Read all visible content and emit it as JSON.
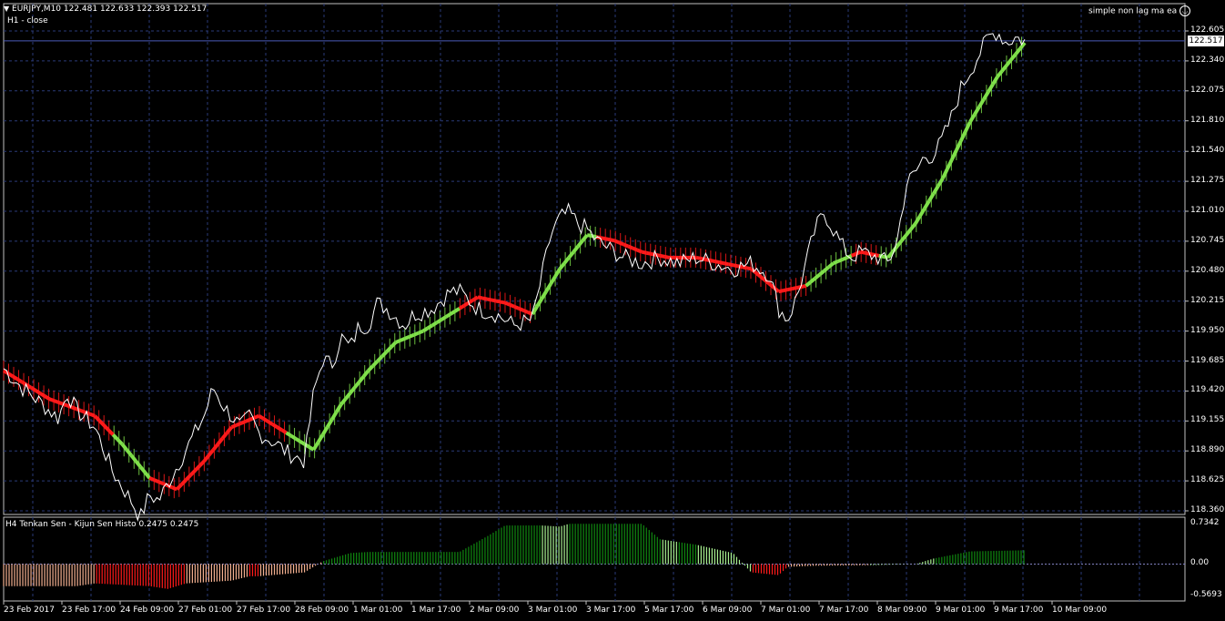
{
  "header": {
    "symbol_line": "EURJPY,M10  122.481 122.633 122.393 122.517",
    "sub_label": "H1 - close",
    "ea_label": "simple non lag ma ea"
  },
  "indicator": {
    "label": "H4  Tenkan Sen - Kijun Sen Histo 0.2475 0.2475",
    "axis": [
      "0.7342",
      "0.00",
      "-0.5693"
    ]
  },
  "current_price": "122.517",
  "price_axis": [
    "122.605",
    "122.340",
    "122.075",
    "121.810",
    "121.540",
    "121.275",
    "121.010",
    "120.745",
    "120.480",
    "120.215",
    "119.950",
    "119.685",
    "119.420",
    "119.155",
    "118.890",
    "118.625",
    "118.360"
  ],
  "date_axis": [
    "23 Feb 2017",
    "23 Feb 17:00",
    "24 Feb 09:00",
    "27 Feb 01:00",
    "27 Feb 17:00",
    "28 Feb 09:00",
    "1 Mar 01:00",
    "1 Mar 17:00",
    "2 Mar 09:00",
    "3 Mar 01:00",
    "3 Mar 17:00",
    "5 Mar 17:00",
    "6 Mar 09:00",
    "7 Mar 01:00",
    "7 Mar 17:00",
    "8 Mar 09:00",
    "9 Mar 01:00",
    "9 Mar 17:00",
    "10 Mar 09:00"
  ],
  "colors": {
    "background": "#000000",
    "grid": "#2a3a78",
    "bull": "#7fe04a",
    "bear": "#ff1a1a",
    "close_line": "#ffffff",
    "histo_up": "#108a10",
    "histo_down": "#ff1a1a",
    "histo_down_light": "#f4b090",
    "histo_up_light": "#a8f090"
  },
  "chart_data": {
    "type": "line",
    "title": "EURJPY,M10",
    "ylim": [
      118.36,
      122.605
    ],
    "price_close_path": [
      [
        0,
        119.62
      ],
      [
        2,
        119.45
      ],
      [
        4,
        119.32
      ],
      [
        6,
        119.18
      ],
      [
        7,
        119.4
      ],
      [
        8,
        119.25
      ],
      [
        10,
        119.1
      ],
      [
        12,
        118.7
      ],
      [
        14,
        118.45
      ],
      [
        15,
        118.3
      ],
      [
        16,
        118.5
      ],
      [
        17,
        118.45
      ],
      [
        18,
        118.6
      ],
      [
        20,
        118.9
      ],
      [
        22,
        119.2
      ],
      [
        23,
        119.45
      ],
      [
        24,
        119.3
      ],
      [
        26,
        119.1
      ],
      [
        27,
        119.2
      ],
      [
        28,
        119.05
      ],
      [
        30,
        118.95
      ],
      [
        31,
        118.88
      ],
      [
        33,
        118.8
      ],
      [
        34,
        119.4
      ],
      [
        35,
        119.7
      ],
      [
        36,
        119.65
      ],
      [
        37,
        119.9
      ],
      [
        38,
        119.8
      ],
      [
        39,
        120.0
      ],
      [
        40,
        120.0
      ],
      [
        41,
        120.2
      ],
      [
        42,
        120.15
      ],
      [
        44,
        120.0
      ],
      [
        45,
        120.1
      ],
      [
        47,
        120.15
      ],
      [
        49,
        120.3
      ],
      [
        50,
        120.3
      ],
      [
        52,
        120.15
      ],
      [
        54,
        120.1
      ],
      [
        56,
        120.0
      ],
      [
        58,
        120.05
      ],
      [
        60,
        120.8
      ],
      [
        61,
        120.95
      ],
      [
        62,
        121.0
      ],
      [
        63,
        120.9
      ],
      [
        64,
        120.85
      ],
      [
        65,
        120.75
      ],
      [
        66,
        120.7
      ],
      [
        68,
        120.6
      ],
      [
        70,
        120.55
      ],
      [
        72,
        120.6
      ],
      [
        74,
        120.55
      ],
      [
        76,
        120.6
      ],
      [
        78,
        120.55
      ],
      [
        80,
        120.5
      ],
      [
        82,
        120.55
      ],
      [
        84,
        120.45
      ],
      [
        85,
        120.15
      ],
      [
        86,
        120.05
      ],
      [
        87,
        120.25
      ],
      [
        88,
        120.55
      ],
      [
        89,
        120.85
      ],
      [
        90,
        121.0
      ],
      [
        91,
        120.85
      ],
      [
        92,
        120.7
      ],
      [
        93,
        120.6
      ],
      [
        94,
        120.65
      ],
      [
        96,
        120.6
      ],
      [
        97,
        120.55
      ],
      [
        98,
        120.75
      ],
      [
        99,
        121.25
      ],
      [
        100,
        121.35
      ],
      [
        101,
        121.5
      ],
      [
        102,
        121.5
      ],
      [
        103,
        121.65
      ],
      [
        104,
        121.85
      ],
      [
        105,
        122.1
      ],
      [
        106,
        122.25
      ],
      [
        107,
        122.4
      ],
      [
        108,
        122.55
      ],
      [
        109,
        122.6
      ],
      [
        110,
        122.5
      ],
      [
        111,
        122.55
      ],
      [
        112,
        122.517
      ]
    ],
    "nonlag_ma": [
      [
        0,
        119.6
      ],
      [
        5,
        119.35
      ],
      [
        10,
        119.2
      ],
      [
        13,
        118.95
      ],
      [
        16,
        118.65
      ],
      [
        19,
        118.55
      ],
      [
        22,
        118.8
      ],
      [
        25,
        119.1
      ],
      [
        28,
        119.2
      ],
      [
        31,
        119.05
      ],
      [
        34,
        118.9
      ],
      [
        37,
        119.3
      ],
      [
        40,
        119.6
      ],
      [
        43,
        119.85
      ],
      [
        46,
        119.95
      ],
      [
        49,
        120.1
      ],
      [
        52,
        120.25
      ],
      [
        55,
        120.2
      ],
      [
        58,
        120.1
      ],
      [
        61,
        120.5
      ],
      [
        64,
        120.8
      ],
      [
        67,
        120.75
      ],
      [
        70,
        120.65
      ],
      [
        73,
        120.6
      ],
      [
        76,
        120.6
      ],
      [
        79,
        120.55
      ],
      [
        82,
        120.5
      ],
      [
        85,
        120.3
      ],
      [
        88,
        120.35
      ],
      [
        91,
        120.55
      ],
      [
        94,
        120.65
      ],
      [
        97,
        120.6
      ],
      [
        100,
        120.9
      ],
      [
        103,
        121.3
      ],
      [
        106,
        121.8
      ],
      [
        109,
        122.2
      ],
      [
        112,
        122.5
      ]
    ],
    "nonlag_trend": "down:0-12,up:12-16,down:16-31,up:31-50,down:50-58,up:58-65,down:65-88,up:88-93,down:93-96,up:96-112",
    "histogram": {
      "ylim": [
        -0.5693,
        0.7342
      ],
      "values": [
        [
          0,
          -0.4,
          "dl"
        ],
        [
          8,
          -0.4,
          "dl"
        ],
        [
          10,
          -0.35,
          "d"
        ],
        [
          16,
          -0.4,
          "d"
        ],
        [
          18,
          -0.45,
          "d"
        ],
        [
          20,
          -0.35,
          "dl"
        ],
        [
          25,
          -0.3,
          "dl"
        ],
        [
          27,
          -0.22,
          "d"
        ],
        [
          28,
          -0.22,
          "dl"
        ],
        [
          33,
          -0.15,
          "dl"
        ],
        [
          35,
          0.05,
          "u"
        ],
        [
          38,
          0.2,
          "u"
        ],
        [
          40,
          0.22,
          "u"
        ],
        [
          50,
          0.22,
          "u"
        ],
        [
          53,
          0.5,
          "u"
        ],
        [
          55,
          0.7,
          "u"
        ],
        [
          59,
          0.7,
          "ul"
        ],
        [
          61,
          0.68,
          "ul"
        ],
        [
          62,
          0.73,
          "u"
        ],
        [
          70,
          0.73,
          "u"
        ],
        [
          72,
          0.45,
          "ul"
        ],
        [
          74,
          0.4,
          "u"
        ],
        [
          76,
          0.35,
          "ul"
        ],
        [
          80,
          0.2,
          "ul"
        ],
        [
          82,
          -0.15,
          "d"
        ],
        [
          85,
          -0.2,
          "d"
        ],
        [
          86,
          -0.05,
          "dl"
        ],
        [
          89,
          -0.03,
          "dl"
        ],
        [
          95,
          -0.02,
          "ul"
        ],
        [
          100,
          0.0,
          "ul"
        ],
        [
          102,
          0.1,
          "u"
        ],
        [
          106,
          0.23,
          "u"
        ],
        [
          112,
          0.25,
          "u"
        ]
      ]
    }
  }
}
